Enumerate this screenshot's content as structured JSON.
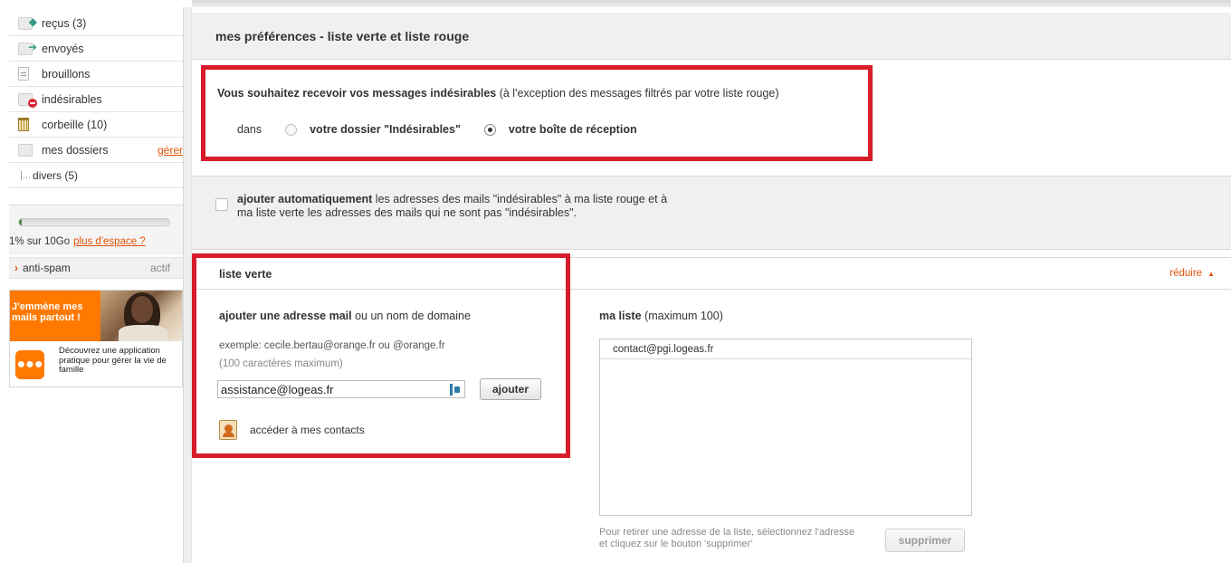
{
  "sidebar": {
    "folders": [
      {
        "label": "reçus (3)",
        "icon": "inbox-arrow-icon"
      },
      {
        "label": "envoyés",
        "icon": "sent-arrow-icon"
      },
      {
        "label": "brouillons",
        "icon": "draft-doc-icon"
      },
      {
        "label": "indésirables",
        "icon": "spam-folder-icon"
      },
      {
        "label": "corbeille (10)",
        "icon": "trash-bin-icon"
      },
      {
        "label": "mes dossiers",
        "icon": "folder-icon",
        "action": "gérer"
      }
    ],
    "subfolder": {
      "tree": "|...",
      "label": "divers (5)"
    },
    "quota": {
      "percent_used": 1,
      "text_prefix": "1% sur ",
      "total": "10Go",
      "more_link": "plus d'espace ?"
    },
    "antispam": {
      "label": "anti-spam",
      "state": "actif"
    },
    "promo": {
      "headline": "J'emmène mes mails partout !",
      "desc": "Découvrez une application pratique pour gérer la vie de famille"
    }
  },
  "page": {
    "title": "mes préférences - liste verte et liste rouge"
  },
  "spam_pref": {
    "question_bold": "Vous souhaitez recevoir vos messages indésirables",
    "question_rest": " (à l'exception des messages filtrés par votre liste rouge)",
    "dans": "dans",
    "option_1": "votre dossier \"Indésirables\"",
    "option_2": "votre boîte de réception",
    "selected": "option_2"
  },
  "auto_add": {
    "bold": "ajouter automatiquement",
    "line1_rest": " les adresses des mails \"indésirables\" à ma liste rouge et à",
    "line2": "ma liste verte les adresses des mails qui ne sont pas \"indésirables\".",
    "checked": false
  },
  "green_list": {
    "header": "liste verte",
    "reduce": "réduire",
    "add_title_bold": "ajouter une adresse mail",
    "add_title_rest": " ou un nom de domaine",
    "example": "exemple: cecile.bertau@orange.fr ou @orange.fr",
    "max_chars": "(100 caractères maximum)",
    "input_value": "assistance@logeas.fr",
    "add_button": "ajouter",
    "contacts_link": "accéder à mes contacts",
    "my_list_bold": "ma liste",
    "my_list_rest": " (maximum 100)",
    "items": [
      "contact@pgi.logeas.fr"
    ],
    "help": "Pour retirer une adresse de la liste, sélectionnez l'adresse et cliquez sur le bouton 'supprimer'",
    "delete_button": "supprimer"
  },
  "colors": {
    "accent": "#e05206",
    "highlight": "#d71c2a",
    "quota_fill": "#4a8c3f"
  }
}
